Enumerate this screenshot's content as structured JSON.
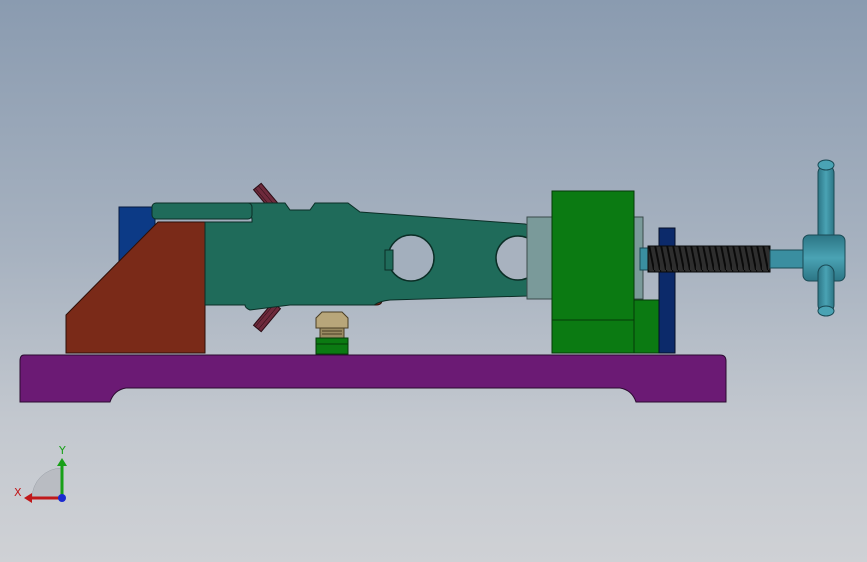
{
  "viewport": {
    "background_top": "#8a9bb0",
    "background_bottom": "#cfd1d5"
  },
  "model": {
    "parts": [
      {
        "name": "base-plate",
        "color": "#6b1a74"
      },
      {
        "name": "body-block",
        "color": "#7a2a18"
      },
      {
        "name": "blue-stop",
        "color": "#0c3a86"
      },
      {
        "name": "clamp-arm",
        "color": "#1f6b5a"
      },
      {
        "name": "green-block",
        "color": "#0b7a12"
      },
      {
        "name": "screw-thread",
        "color": "#1a1a1a"
      },
      {
        "name": "handle",
        "color": "#3a8ea0"
      },
      {
        "name": "support-nut",
        "color": "#b8a67a"
      },
      {
        "name": "end-plate",
        "color": "#0c2a6a"
      },
      {
        "name": "spring-coil",
        "color": "#6a2a3a"
      }
    ]
  },
  "triad": {
    "x_label": "X",
    "y_label": "Y",
    "x_color": "#c0181a",
    "y_color": "#18a018",
    "z_color": "#1a2ad0"
  }
}
